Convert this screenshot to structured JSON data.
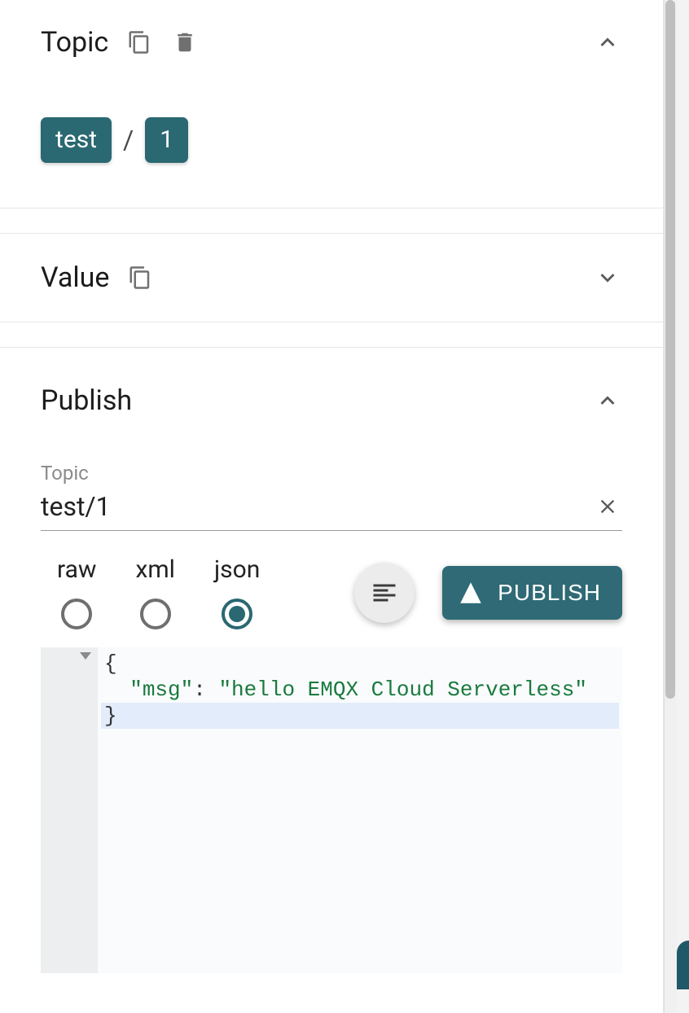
{
  "topicPanel": {
    "title": "Topic",
    "segments": [
      "test",
      "1"
    ],
    "separator": "/"
  },
  "valuePanel": {
    "title": "Value"
  },
  "publishPanel": {
    "title": "Publish",
    "topicLabel": "Topic",
    "topicValue": "test/1",
    "formats": {
      "raw": "raw",
      "xml": "xml",
      "json": "json",
      "selected": "json"
    },
    "publishButton": "PUBLISH",
    "payload": {
      "line1": "{",
      "line2_key": "\"msg\"",
      "line2_colon": ": ",
      "line2_val": "\"hello EMQX Cloud Serverless\"",
      "line3": "}"
    }
  },
  "colors": {
    "accent": "#2a6872"
  }
}
